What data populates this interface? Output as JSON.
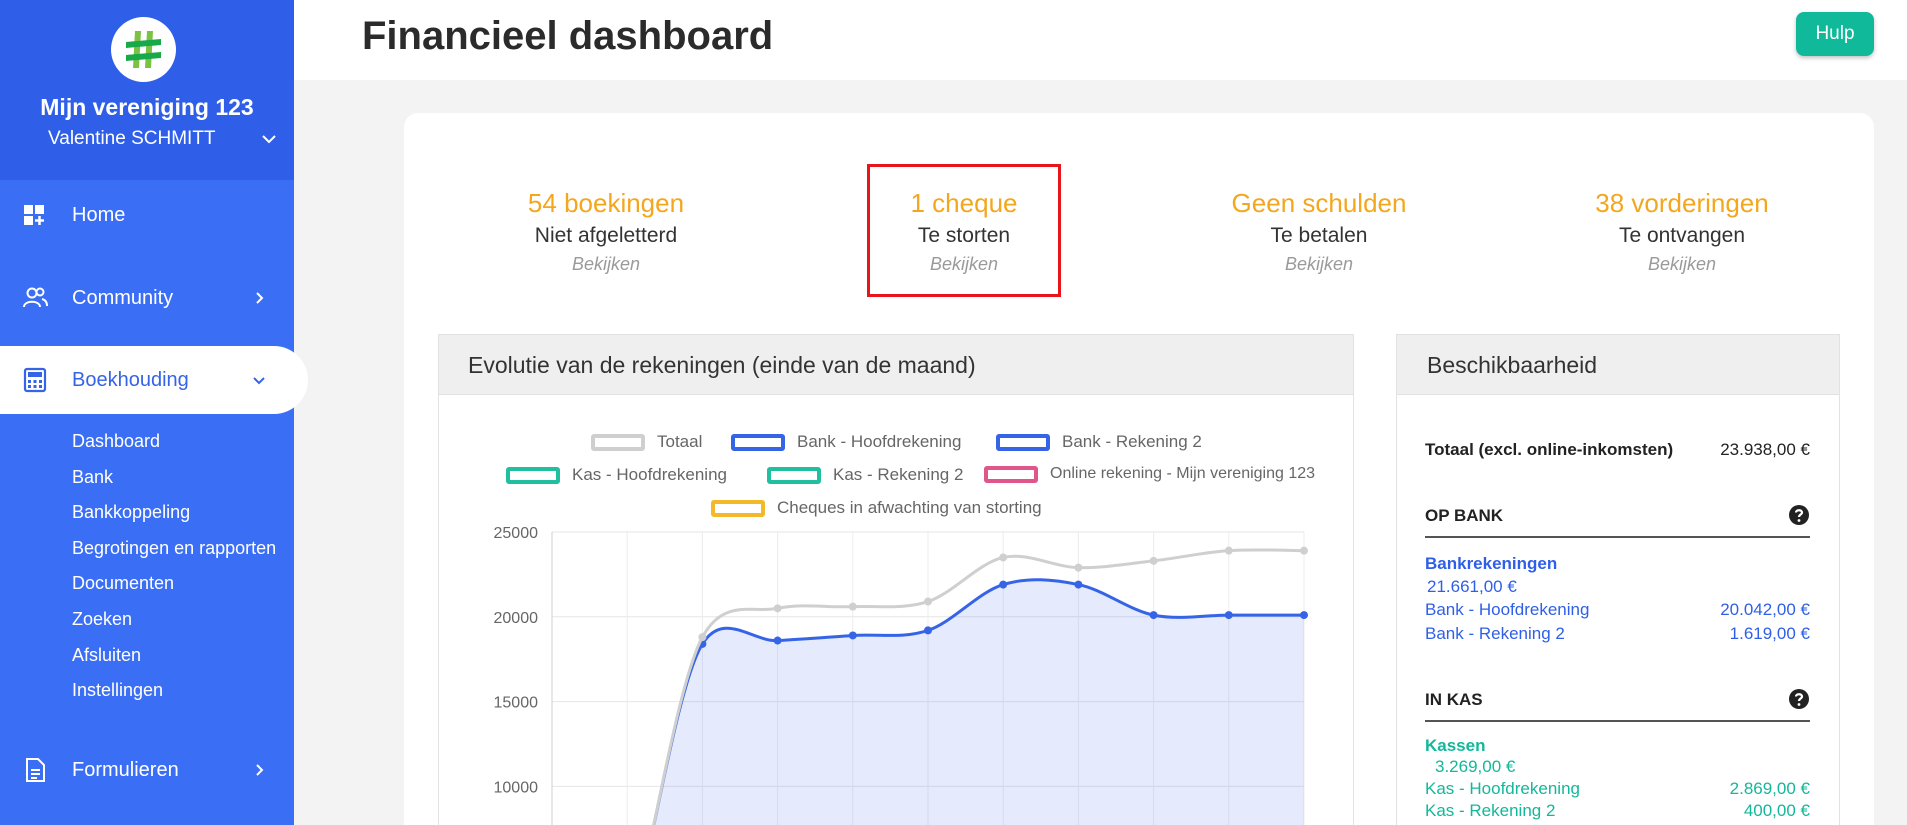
{
  "sidebar": {
    "org_name": "Mijn vereniging 123",
    "user_name": "Valentine SCHMITT",
    "nav": [
      {
        "label": "Home",
        "icon": "dashboard-icon"
      },
      {
        "label": "Community",
        "icon": "users-icon"
      },
      {
        "label": "Boekhouding",
        "icon": "calculator-icon"
      },
      {
        "label": "Formulieren",
        "icon": "document-icon"
      }
    ],
    "sub_items": [
      "Dashboard",
      "Bank",
      "Bankkoppeling",
      "Begrotingen en rapporten",
      "Documenten",
      "Zoeken",
      "Afsluiten",
      "Instellingen"
    ]
  },
  "header": {
    "title": "Financieel dashboard",
    "help_label": "Hulp"
  },
  "kpis": [
    {
      "value": "54 boekingen",
      "label": "Niet afgeletterd",
      "link": "Bekijken"
    },
    {
      "value": "1 cheque",
      "label": "Te storten",
      "link": "Bekijken"
    },
    {
      "value": "Geen schulden",
      "label": "Te betalen",
      "link": "Bekijken"
    },
    {
      "value": "38 vorderingen",
      "label": "Te ontvangen",
      "link": "Bekijken"
    }
  ],
  "chart_panel": {
    "title": "Evolutie van de rekeningen (einde van de maand)"
  },
  "chart_data": {
    "type": "line",
    "title": "Evolutie van de rekeningen (einde van de maand)",
    "yticks": [
      25000,
      20000,
      15000,
      10000
    ],
    "series": [
      {
        "name": "Totaal",
        "color": "#cfcfcf",
        "values": [
          null,
          null,
          18800,
          20500,
          20600,
          20900,
          23500,
          22900,
          23300,
          23900,
          23900
        ]
      },
      {
        "name": "Bank - Hoofdrekening",
        "color": "#3564e6",
        "values": [
          null,
          null,
          18400,
          18600,
          18900,
          19200,
          21900,
          21900,
          20100,
          20100,
          20100
        ]
      },
      {
        "name": "Bank - Rekening 2",
        "color": "#3564e6",
        "values": []
      },
      {
        "name": "Kas - Hoofdrekening",
        "color": "#1fbfa0",
        "values": []
      },
      {
        "name": "Kas - Rekening 2",
        "color": "#1fbfa0",
        "values": []
      },
      {
        "name": "Online rekening - Mijn vereniging 123",
        "color": "#e0558a",
        "values": []
      },
      {
        "name": "Cheques in afwachting van storting",
        "color": "#f4b928",
        "values": []
      }
    ]
  },
  "availability": {
    "title": "Beschikbaarheid",
    "total_label": "Totaal (excl. online-inkomsten)",
    "total_value": "23.938,00 €",
    "bank": {
      "section": "OP BANK",
      "group": "Bankrekeningen",
      "group_total": "21.661,00 €",
      "rows": [
        {
          "label": "Bank - Hoofdrekening",
          "value": "20.042,00 €"
        },
        {
          "label": "Bank - Rekening 2",
          "value": "1.619,00 €"
        }
      ]
    },
    "cash": {
      "section": "IN KAS",
      "group": "Kassen",
      "group_total": "3.269,00 €",
      "rows": [
        {
          "label": "Kas - Hoofdrekening",
          "value": "2.869,00 €"
        },
        {
          "label": "Kas - Rekening 2",
          "value": "400,00 €"
        }
      ]
    }
  }
}
